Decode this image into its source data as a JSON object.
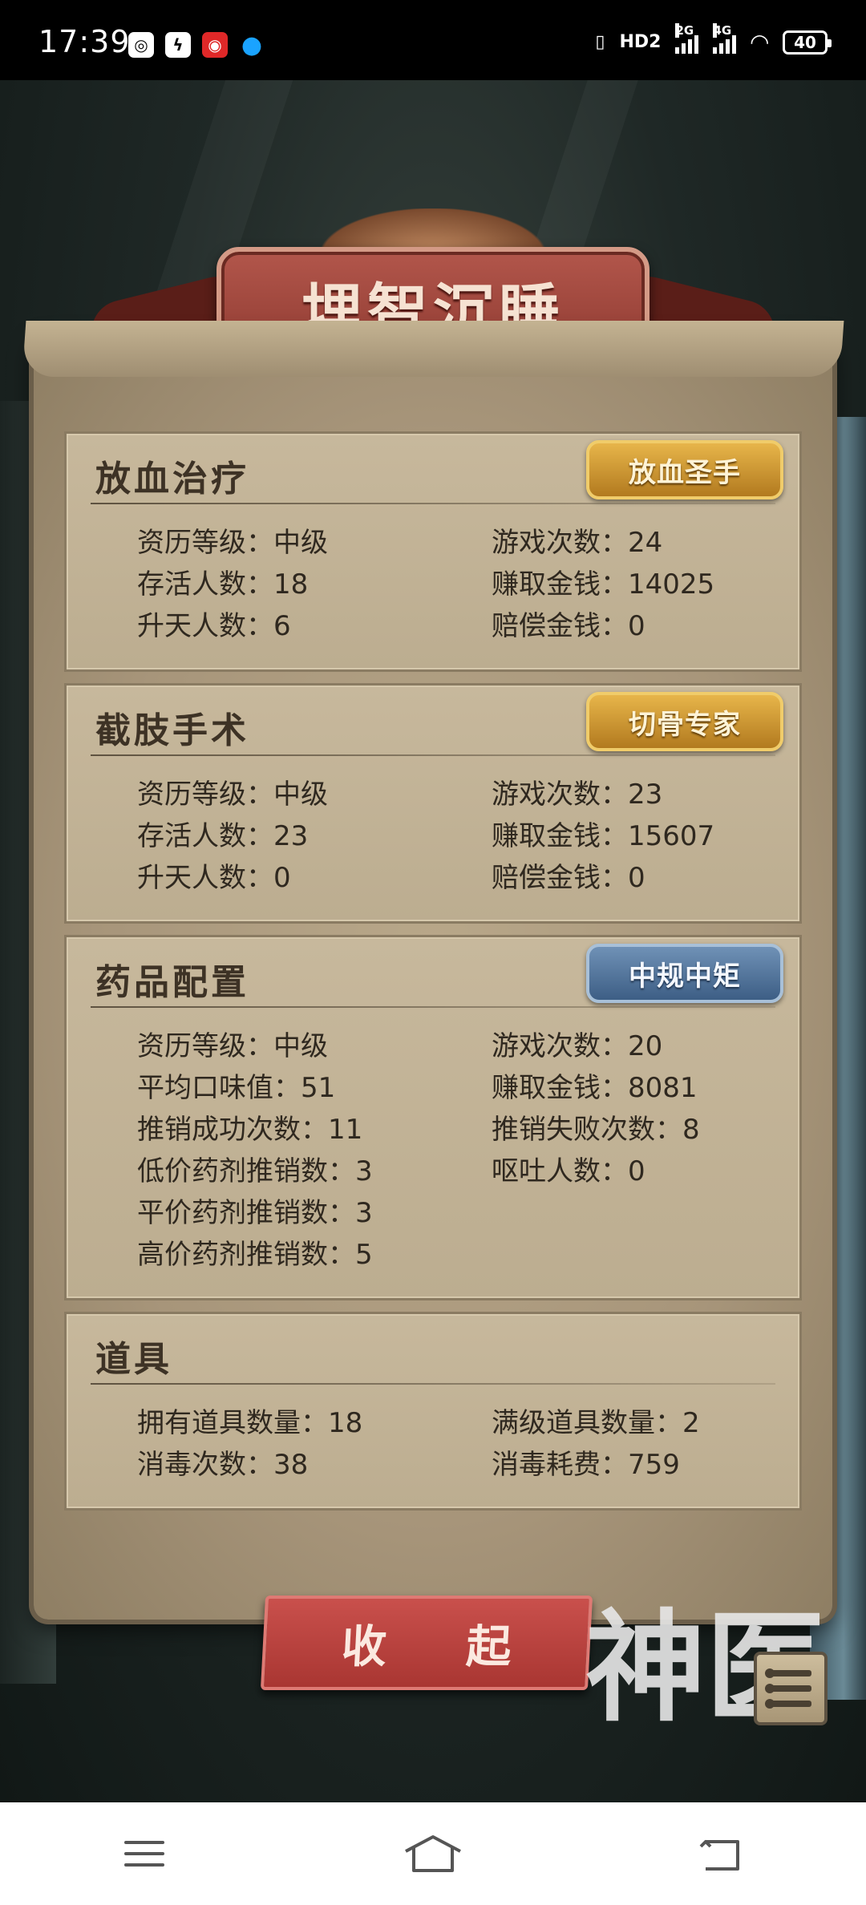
{
  "status_bar": {
    "time": "17:39",
    "battery": "40",
    "network_1": "2G",
    "network_2": "4G",
    "hd_label": "HD2"
  },
  "title": "埋智沉睡",
  "sections": [
    {
      "title": "放血治疗",
      "badge": "放血圣手",
      "badge_color": "#d9a338",
      "stats_left": [
        "资历等级：中级",
        "存活人数：18",
        "升天人数：6"
      ],
      "stats_right": [
        "游戏次数：24",
        "赚取金钱：14025",
        "赔偿金钱：0"
      ]
    },
    {
      "title": "截肢手术",
      "badge": "切骨专家",
      "badge_color": "#d9a338",
      "stats_left": [
        "资历等级：中级",
        "存活人数：23",
        "升天人数：0"
      ],
      "stats_right": [
        "游戏次数：23",
        "赚取金钱：15607",
        "赔偿金钱：0"
      ]
    },
    {
      "title": "药品配置",
      "badge": "中规中矩",
      "badge_color": "#5577a0",
      "stats_left": [
        "资历等级：中级",
        "平均口味值：51",
        "推销成功次数：11",
        "低价药剂推销数：3",
        "平价药剂推销数：3",
        "高价药剂推销数：5"
      ],
      "stats_right": [
        "游戏次数：20",
        "赚取金钱：8081",
        "推销失败次数：8",
        "呕吐人数：0"
      ]
    },
    {
      "title": "道具",
      "stats_left": [
        "拥有道具数量：18",
        "消毒次数：38"
      ],
      "stats_right": [
        "满级道具数量：2",
        "消毒耗费：759"
      ]
    }
  ],
  "collapse_button": "收 起",
  "logo_text": "神医",
  "icons": {
    "menu": "list-menu-icon",
    "nav_menu": "hamburger-icon",
    "nav_home": "home-icon",
    "nav_back": "back-icon"
  }
}
